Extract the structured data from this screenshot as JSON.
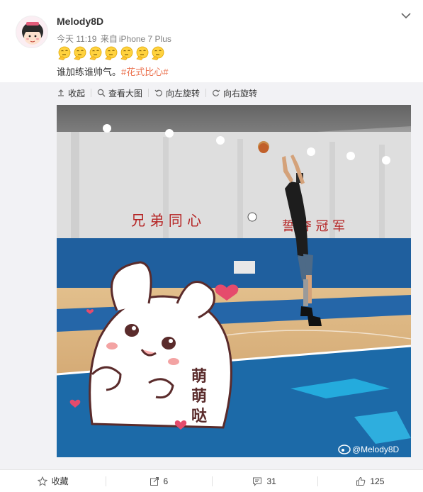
{
  "post": {
    "username": "Melody8D",
    "time": "今天 11:19",
    "source_prefix": "来自",
    "device": "iPhone 7 Plus",
    "text": "谁加练谁帅气。",
    "hashtag": "#花式比心#",
    "emoji_count": 7,
    "emoji_name": "thinking-face-emoji"
  },
  "toolbar": {
    "collapse_label": "收起",
    "view_large_label": "查看大图",
    "rotate_left_label": "向左旋转",
    "rotate_right_label": "向右旋转"
  },
  "image": {
    "wall_slogan_left": "兄 弟 同 心",
    "wall_slogan_right": "誓 夺 冠 军",
    "sticker_text": "萌萌哒",
    "sticker_char_1": "萌",
    "sticker_char_2": "萌",
    "sticker_char_3": "哒",
    "watermark": "@Melody8D"
  },
  "actions": {
    "favorite_label": "收藏",
    "repost_count": "6",
    "comment_count": "31",
    "like_count": "125"
  },
  "colors": {
    "accent": "#eb7350",
    "muted": "#808080",
    "court_blue": "#1f6fae",
    "floor": "#d9b07a"
  }
}
